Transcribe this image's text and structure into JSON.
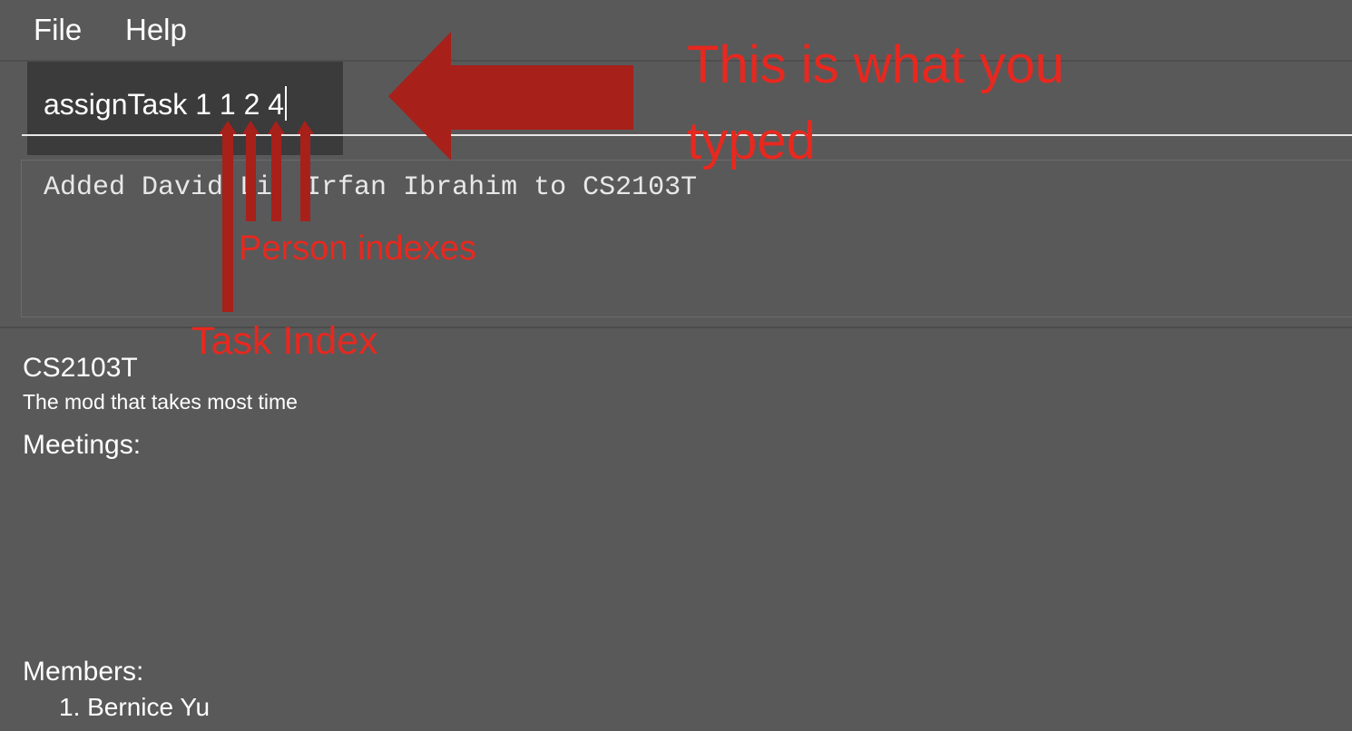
{
  "menu": {
    "file": "File",
    "help": "Help"
  },
  "command": {
    "text": "assignTask 1 1 2 4"
  },
  "result": {
    "message": "Added David Li, Irfan Ibrahim to CS2103T"
  },
  "group": {
    "name": "CS2103T",
    "description": "The mod that takes most time",
    "meetings_label": "Meetings:",
    "members_label": "Members:",
    "members": [
      "1. Bernice Yu"
    ]
  },
  "annotations": {
    "typed_label": "This is what you typed",
    "person_indexes_label": "Person indexes",
    "task_index_label": "Task Index",
    "color": "#e8281f",
    "arrow_color": "#a8201a"
  },
  "colors": {
    "background": "#595959",
    "command_box": "#3b3b3b",
    "text": "#ffffff"
  }
}
